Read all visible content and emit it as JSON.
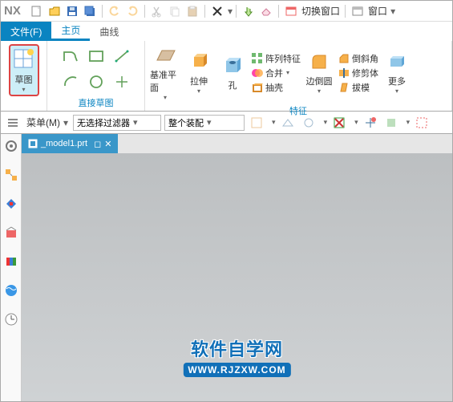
{
  "title": {
    "app": "NX"
  },
  "titlebar": {
    "switch_window": "切换窗口",
    "window_menu": "窗口"
  },
  "menu": {
    "file": "文件(F)",
    "home": "主页",
    "curve": "曲线"
  },
  "ribbon": {
    "sketch": {
      "label": "草图",
      "group_label": "直接草图"
    },
    "datum_plane": "基准平面",
    "extrude": "拉伸",
    "hole": "孔",
    "features_group": "特征",
    "pattern": "阵列特征",
    "unite": "合并",
    "shell": "抽壳",
    "edge_blend": "边倒圆",
    "chamfer": "倒斜角",
    "trim": "修剪体",
    "draft": "拔模",
    "more": "更多"
  },
  "selbar": {
    "menu_btn": "菜单(M)",
    "filter": "无选择过滤器",
    "assembly": "整个装配"
  },
  "doc": {
    "name": "_model1.prt"
  },
  "watermark": {
    "top": "软件自学网",
    "bottom": "WWW.RJZXW.COM"
  }
}
